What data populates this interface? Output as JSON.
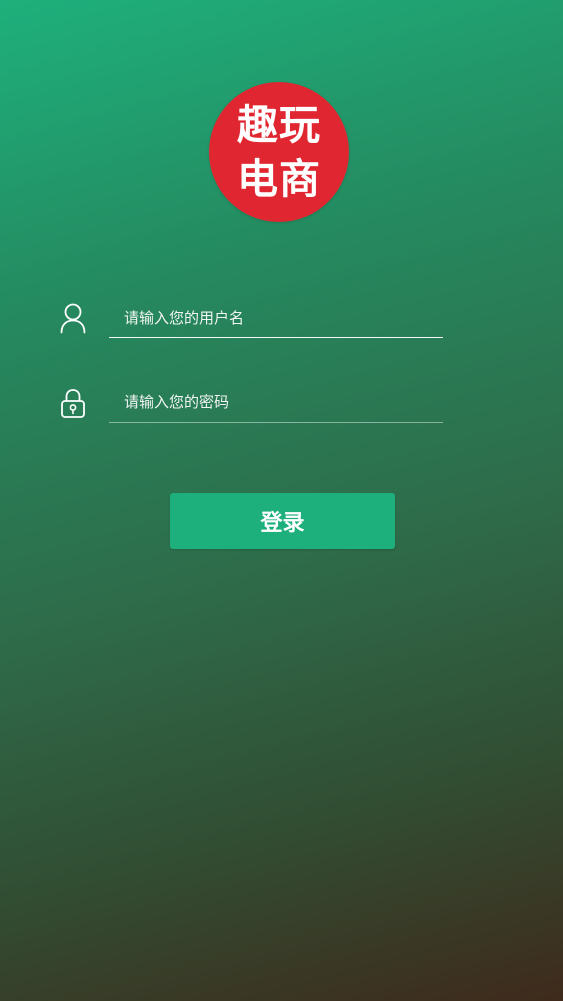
{
  "logo": {
    "line1": "趣玩",
    "line2": "电商",
    "background_color": "#e02731"
  },
  "form": {
    "username": {
      "icon": "user-icon",
      "value": "",
      "placeholder": "请输入您的用户名"
    },
    "password": {
      "icon": "lock-icon",
      "value": "",
      "placeholder": "请输入您的密码"
    }
  },
  "login_button": {
    "label": "登录",
    "color": "#1eb07c"
  },
  "theme": {
    "gradient_top": "#1eb07c",
    "gradient_bottom": "#3f2a1c",
    "text_color": "#ffffff"
  }
}
